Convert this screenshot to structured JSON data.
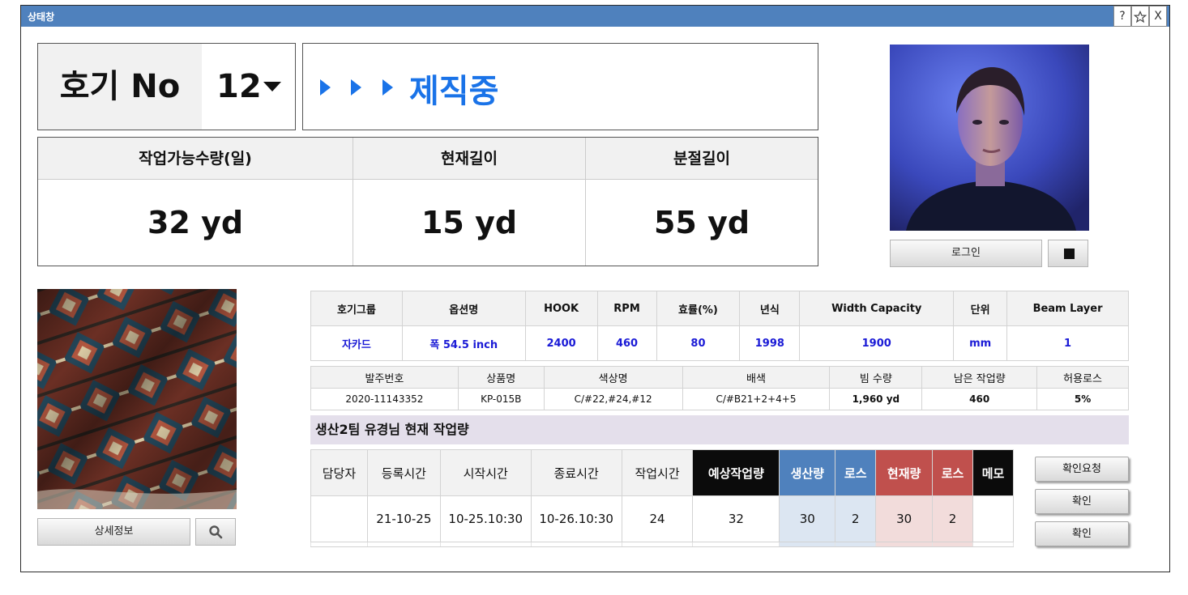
{
  "window": {
    "title": "상태창",
    "help_label": "?",
    "close_label": "X"
  },
  "machine": {
    "label": "호기 No",
    "selected": "12",
    "status": "제직중"
  },
  "stats": [
    {
      "label": "작업가능수량(일)",
      "value": "32 yd"
    },
    {
      "label": "현재길이",
      "value": "15 yd"
    },
    {
      "label": "분절길이",
      "value": "55 yd"
    }
  ],
  "profile": {
    "login_label": "로그인"
  },
  "fabric": {
    "detail_label": "상세정보"
  },
  "spec_table": {
    "headers": [
      "호기그룹",
      "옵션명",
      "HOOK",
      "RPM",
      "효률(%)",
      "년식",
      "Width Capacity",
      "단위",
      "Beam Layer"
    ],
    "values": [
      "자카드",
      "폭 54.5 inch",
      "2400",
      "460",
      "80",
      "1998",
      "1900",
      "mm",
      "1"
    ]
  },
  "order_table": {
    "headers": [
      "발주번호",
      "상품명",
      "색상명",
      "배색",
      "빔 수량",
      "남은 작업량",
      "허용로스"
    ],
    "values": [
      "2020-11143352",
      "KP-015B",
      "C/#22,#24,#12",
      "C/#B21+2+4+5",
      "1,960 yd",
      "460",
      "5%"
    ]
  },
  "work": {
    "title": "생산2팀 유경님 현재 작업량",
    "headers": [
      "담당자",
      "등록시간",
      "시작시간",
      "종료시간",
      "작업시간",
      "예상작업량",
      "생산량",
      "로스",
      "현재량",
      "로스",
      "메모"
    ],
    "row": [
      "",
      "21-10-25",
      "10-25.10:30",
      "10-26.10:30",
      "24",
      "32",
      "30",
      "2",
      "30",
      "2",
      ""
    ]
  },
  "actions": {
    "request_label": "확인요청",
    "confirm_label_1": "확인",
    "confirm_label_2": "확인"
  },
  "colors": {
    "titlebar": "#4f81bd",
    "status_blue": "#1a73e8",
    "production_blue": "#4f81bd",
    "current_red": "#c0504d",
    "banner": "#e4dfeb"
  },
  "icons": [
    "star-icon",
    "triangle-right-icon",
    "caret-down-icon",
    "stop-icon",
    "search-icon"
  ]
}
